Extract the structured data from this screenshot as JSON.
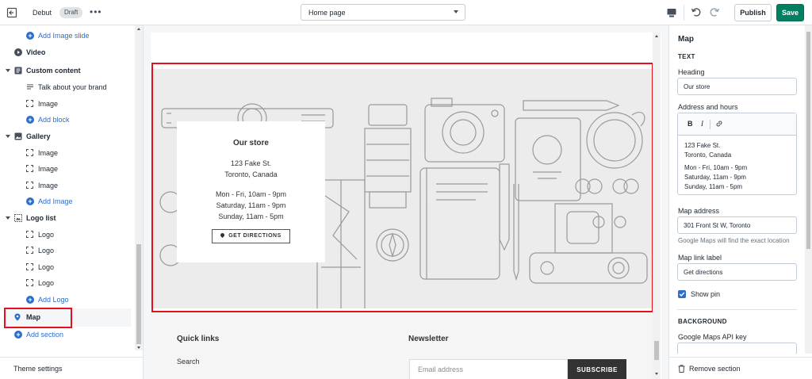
{
  "topbar": {
    "theme_name": "Debut",
    "status_badge": "Draft",
    "page_selector": "Home page",
    "publish_label": "Publish",
    "save_label": "Save"
  },
  "sidebar": {
    "items": [
      {
        "type": "add",
        "label": "Add Image slide",
        "icon": "plus-circle-icon"
      },
      {
        "type": "section",
        "label": "Video",
        "icon": "play-icon"
      },
      {
        "type": "section",
        "label": "Custom content",
        "icon": "text-block-icon",
        "expanded": true
      },
      {
        "type": "block",
        "label": "Talk about your brand",
        "icon": "text-lines-icon"
      },
      {
        "type": "block",
        "label": "Image",
        "icon": "image-placeholder-icon"
      },
      {
        "type": "add",
        "label": "Add block",
        "icon": "plus-circle-icon"
      },
      {
        "type": "section",
        "label": "Gallery",
        "icon": "gallery-icon",
        "expanded": true
      },
      {
        "type": "block",
        "label": "Image",
        "icon": "image-placeholder-icon"
      },
      {
        "type": "block",
        "label": "Image",
        "icon": "image-placeholder-icon"
      },
      {
        "type": "block",
        "label": "Image",
        "icon": "image-placeholder-icon"
      },
      {
        "type": "add",
        "label": "Add Image",
        "icon": "plus-circle-icon"
      },
      {
        "type": "section",
        "label": "Logo list",
        "icon": "logo-list-icon",
        "expanded": true
      },
      {
        "type": "block",
        "label": "Logo",
        "icon": "image-placeholder-icon"
      },
      {
        "type": "block",
        "label": "Logo",
        "icon": "image-placeholder-icon"
      },
      {
        "type": "block",
        "label": "Logo",
        "icon": "image-placeholder-icon"
      },
      {
        "type": "block",
        "label": "Logo",
        "icon": "image-placeholder-icon"
      },
      {
        "type": "add",
        "label": "Add Logo",
        "icon": "plus-circle-icon"
      },
      {
        "type": "section",
        "label": "Map",
        "icon": "map-pin-icon",
        "selected": true
      },
      {
        "type": "add",
        "label": "Add section",
        "icon": "plus-circle-icon"
      }
    ],
    "theme_settings": "Theme settings"
  },
  "preview": {
    "store": {
      "heading": "Our store",
      "address_line1": "123 Fake St.",
      "address_line2": "Toronto, Canada",
      "hours_line1": "Mon - Fri, 10am - 9pm",
      "hours_line2": "Saturday, 11am - 9pm",
      "hours_line3": "Sunday, 11am - 5pm",
      "directions_button": "GET DIRECTIONS"
    },
    "footer": {
      "quick_links_title": "Quick links",
      "search_link": "Search",
      "newsletter_title": "Newsletter",
      "email_placeholder": "Email address",
      "subscribe_label": "SUBSCRIBE"
    }
  },
  "settings": {
    "title": "Map",
    "text_heading": "TEXT",
    "heading_label": "Heading",
    "heading_value": "Our store",
    "address_label": "Address and hours",
    "editor_bold": "B",
    "editor_italic": "I",
    "address_lines": [
      "123 Fake St.",
      "Toronto, Canada",
      "Mon - Fri, 10am - 9pm",
      "Saturday, 11am - 9pm",
      "Sunday, 11am - 5pm"
    ],
    "map_address_label": "Map address",
    "map_address_value": "301 Front St W, Toronto",
    "map_address_help": "Google Maps will find the exact location",
    "map_link_label": "Map link label",
    "map_link_value": "Get directions",
    "show_pin_label": "Show pin",
    "show_pin_checked": true,
    "background_heading": "BACKGROUND",
    "api_key_label": "Google Maps API key",
    "remove_section": "Remove section"
  },
  "colors": {
    "accent_blue": "#2c6ecb",
    "save_green": "#008060",
    "selection_red": "#e4101c"
  }
}
